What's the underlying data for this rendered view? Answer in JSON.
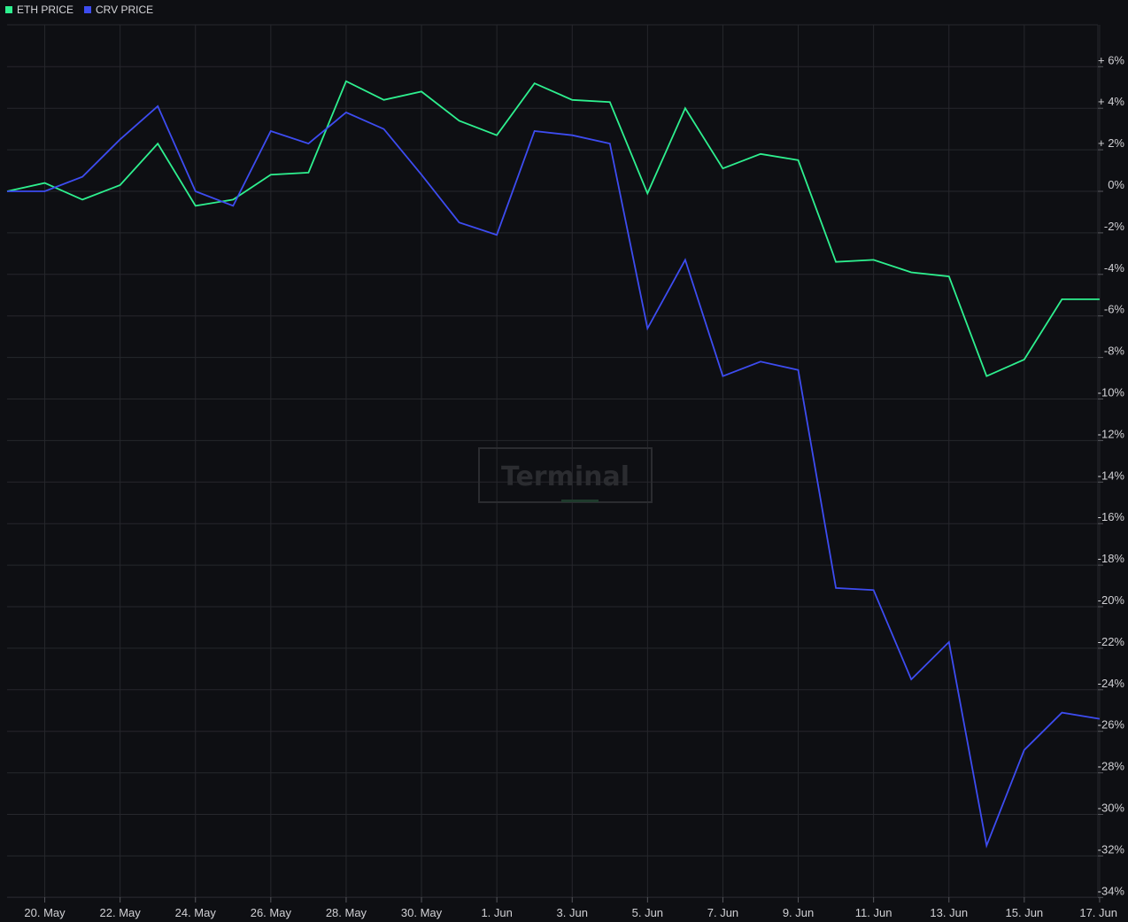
{
  "chart_data": {
    "type": "line",
    "title": "",
    "xlabel": "",
    "ylabel": "",
    "x": [
      "19. May",
      "20. May",
      "21. May",
      "22. May",
      "23. May",
      "24. May",
      "25. May",
      "26. May",
      "27. May",
      "28. May",
      "29. May",
      "30. May",
      "31. May",
      "1. Jun",
      "2. Jun",
      "3. Jun",
      "4. Jun",
      "5. Jun",
      "6. Jun",
      "7. Jun",
      "8. Jun",
      "9. Jun",
      "10. Jun",
      "11. Jun",
      "12. Jun",
      "13. Jun",
      "14. Jun",
      "15. Jun",
      "16. Jun",
      "17. Jun"
    ],
    "x_tick_labels": [
      "20. May",
      "22. May",
      "24. May",
      "26. May",
      "28. May",
      "30. May",
      "1. Jun",
      "3. Jun",
      "5. Jun",
      "7. Jun",
      "9. Jun",
      "11. Jun",
      "13. Jun",
      "15. Jun",
      "17. Jun"
    ],
    "y_tick_labels": [
      "+ 6%",
      "+ 4%",
      "+ 2%",
      "0%",
      "-2%",
      "-4%",
      "-6%",
      "-8%",
      "-10%",
      "-12%",
      "-14%",
      "-16%",
      "-18%",
      "-20%",
      "-22%",
      "-24%",
      "-26%",
      "-28%",
      "-30%",
      "-32%",
      "-34%"
    ],
    "ylim": [
      -34,
      7.8
    ],
    "grid": true,
    "legend_position": "top-left",
    "series": [
      {
        "name": "ETH PRICE",
        "color": "#2ef08f",
        "values": [
          0.0,
          0.4,
          -0.4,
          0.3,
          2.3,
          -0.7,
          -0.4,
          0.8,
          0.9,
          5.3,
          4.4,
          4.8,
          3.4,
          2.7,
          5.2,
          4.4,
          4.3,
          -0.1,
          4.0,
          1.1,
          1.8,
          1.5,
          -3.4,
          -3.3,
          -3.9,
          -4.1,
          -8.9,
          -8.1,
          -5.2,
          -5.2
        ]
      },
      {
        "name": "CRV PRICE",
        "color": "#3d4cf0",
        "values": [
          0.0,
          0.0,
          0.7,
          2.5,
          4.1,
          0.0,
          -0.7,
          2.9,
          2.3,
          3.8,
          3.0,
          0.8,
          -1.5,
          -2.1,
          2.9,
          2.7,
          2.3,
          -6.6,
          -3.3,
          -8.9,
          -8.2,
          -8.6,
          -19.1,
          -19.2,
          -23.5,
          -21.7,
          -31.5,
          -26.9,
          -25.1,
          -25.4
        ]
      }
    ]
  },
  "watermark": {
    "text": "Terminal",
    "accent_color": "#1f3a2c"
  },
  "colors": {
    "background": "#0e0f13",
    "grid": "#26272c",
    "axis_text": "#d0d0d4"
  }
}
